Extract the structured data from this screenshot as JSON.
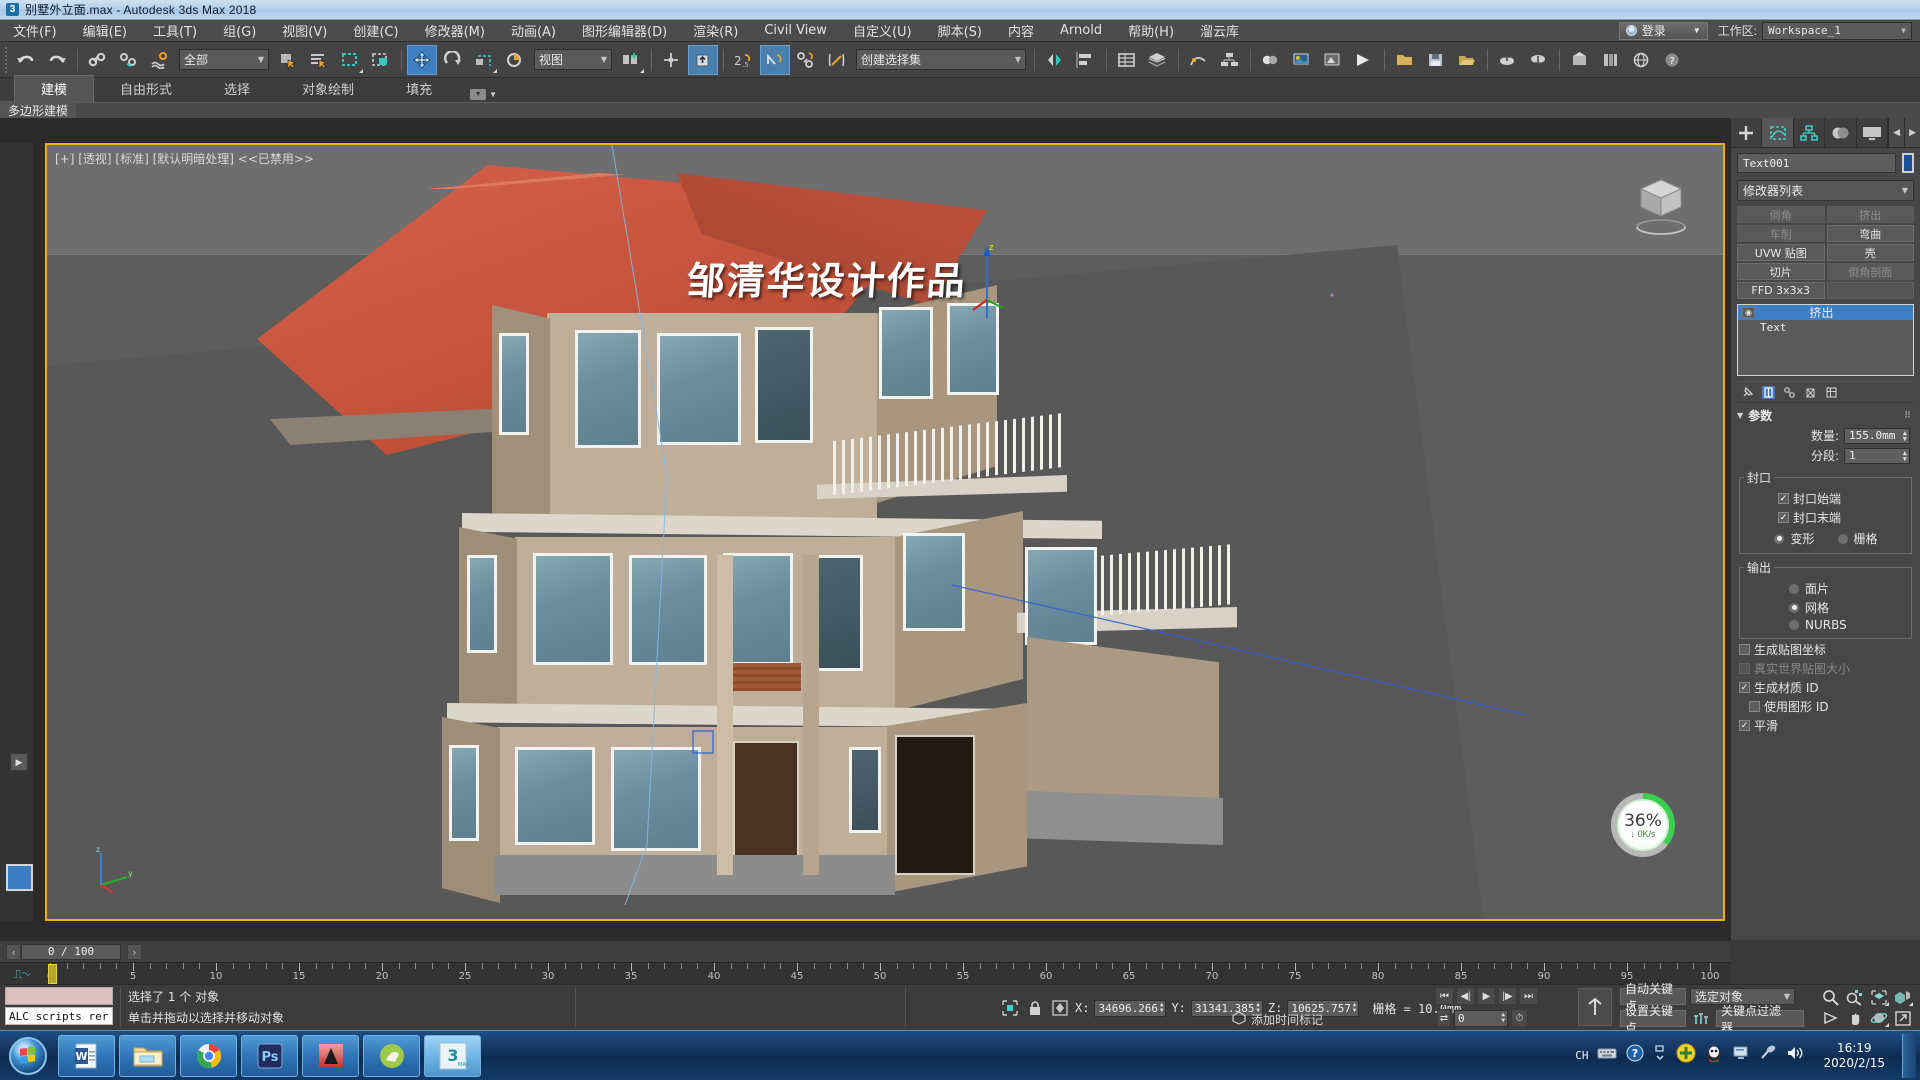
{
  "titlebar": {
    "title": "别墅外立面.max - Autodesk 3ds Max 2018",
    "logo": "3"
  },
  "menubar": {
    "items": [
      "文件(F)",
      "编辑(E)",
      "工具(T)",
      "组(G)",
      "视图(V)",
      "创建(C)",
      "修改器(M)",
      "动画(A)",
      "图形编辑器(D)",
      "渲染(R)",
      "Civil View",
      "自定义(U)",
      "脚本(S)",
      "内容",
      "Arnold",
      "帮助(H)",
      "溜云库"
    ],
    "login_label": "登录",
    "workspace_label": "工作区:",
    "workspace_value": "Workspace_1"
  },
  "toolbar": {
    "undo": "undo-icon",
    "redo": "redo-icon",
    "select_filter": "全部",
    "ref_coord": "视图",
    "named_selection_sets": "创建选择集"
  },
  "ribbon": {
    "tabs": [
      "建模",
      "自由形式",
      "选择",
      "对象绘制",
      "填充"
    ],
    "active_tab": "建模",
    "panel_label": "多边形建模"
  },
  "viewport": {
    "label": "[+] [透视] [标准] [默认明暗处理] <<已禁用>>",
    "watermark": "邹清华设计作品",
    "highlight_color": "#f0b000"
  },
  "download_widget": {
    "percent": "36%",
    "speed": "0K/s",
    "accent": "#3ccf4e"
  },
  "command_panel": {
    "tabs": [
      "create-tab",
      "modify-tab",
      "hierarchy-tab",
      "motion-tab",
      "display-tab"
    ],
    "active_tab_index": 1,
    "object_name": "Text001",
    "object_color": "#1b4f9c",
    "modifier_list_label": "修改器列表",
    "modifier_buttons": [
      {
        "label": "倒角",
        "enabled": false
      },
      {
        "label": "挤出",
        "enabled": false
      },
      {
        "label": "车削",
        "enabled": false
      },
      {
        "label": "弯曲",
        "enabled": true
      },
      {
        "label": "UVW 贴图",
        "enabled": true
      },
      {
        "label": "壳",
        "enabled": true
      },
      {
        "label": "切片",
        "enabled": true
      },
      {
        "label": "倒角剖面",
        "enabled": false
      },
      {
        "label": "FFD 3x3x3",
        "enabled": true
      },
      {
        "label": "",
        "enabled": true
      }
    ],
    "modifier_stack": [
      {
        "label": "挤出",
        "selected": true
      },
      {
        "label": "Text",
        "selected": false
      }
    ],
    "rollout": {
      "title": "参数",
      "amount_label": "数量:",
      "amount_value": "155.0mm",
      "segments_label": "分段:",
      "segments_value": "1",
      "cap_group": "封口",
      "cap_start": "封口始端",
      "cap_start_checked": true,
      "cap_end": "封口末端",
      "cap_end_checked": true,
      "cap_morph": "变形",
      "cap_grid": "栅格",
      "cap_type_selected": "变形",
      "output_group": "输出",
      "output_patch": "面片",
      "output_mesh": "网格",
      "output_nurbs": "NURBS",
      "output_selected": "网格",
      "gen_map_coords": "生成贴图坐标",
      "gen_map_coords_checked": false,
      "real_world_size": "真实世界贴图大小",
      "real_world_size_checked": false,
      "real_world_size_enabled": false,
      "gen_material_ids": "生成材质 ID",
      "gen_material_ids_checked": true,
      "use_shape_ids": "使用图形 ID",
      "use_shape_ids_checked": false,
      "smooth": "平滑",
      "smooth_checked": true
    }
  },
  "timeline": {
    "frame_display": "0 / 100",
    "prev_arrow": "‹",
    "next_arrow": "›",
    "tick_labels": [
      "0",
      "5",
      "10",
      "15",
      "20",
      "25",
      "30",
      "35",
      "40",
      "45",
      "50",
      "55",
      "60",
      "65",
      "70",
      "75",
      "80",
      "85",
      "90",
      "95",
      "100"
    ],
    "current_frame": 0,
    "range_start": 0,
    "range_end": 100
  },
  "status_bar": {
    "maxscript_line": "ALC scripts rer",
    "status_line1": "选择了 1 个 对象",
    "status_line2": "单击并拖动以选择并移动对象",
    "x_label": "X:",
    "x_value": "34696.266",
    "y_label": "Y:",
    "y_value": "31341.385",
    "z_label": "Z:",
    "z_value": "10625.757",
    "grid_text": "栅格 = 10.0mm",
    "add_time_tag": "添加时间标记",
    "frame_field": "0",
    "auto_key": "自动关键点",
    "set_key": "设置关键点",
    "key_filters": "关键点过滤器...",
    "selection_scope": "选定对象"
  },
  "taskbar": {
    "apps": [
      "word-icon",
      "explorer-icon",
      "chrome-icon",
      "photoshop-icon",
      "autocad-icon",
      "sketchup-icon",
      "3dsmax-icon"
    ],
    "active_app_index": 6,
    "tray": [
      "CH",
      "keyboard-icon",
      "help-icon",
      "arrow-icon",
      "greenshield-icon",
      "qq-icon",
      "network-monitor-icon",
      "antenna-icon",
      "volume-icon"
    ],
    "time": "16:19",
    "date": "2020/2/15"
  }
}
